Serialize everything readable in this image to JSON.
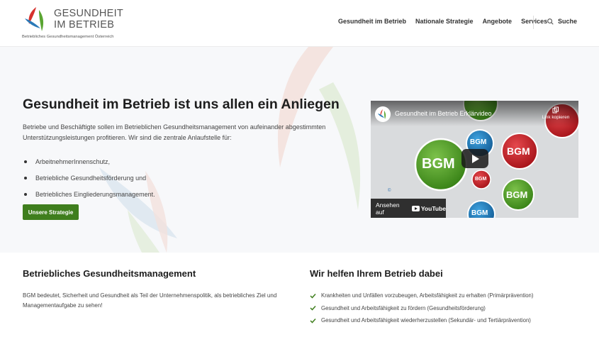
{
  "header": {
    "logo_line1": "GESUNDHEIT",
    "logo_line2": "IM BETRIEB",
    "logo_subtitle": "Betriebliches Gesundheitsmanagement Österreich",
    "nav": [
      {
        "label": "Gesundheit im Betrieb"
      },
      {
        "label": "Nationale Strategie"
      },
      {
        "label": "Angebote"
      },
      {
        "label": "Services"
      }
    ],
    "search_label": "Suche",
    "search_icon": "search-icon"
  },
  "hero": {
    "title": "Gesundheit im Betrieb ist uns allen ein Anliegen",
    "intro": "Betriebe und Beschäftigte sollen im Betrieblichen Gesundheitsmanagement von aufeinander abgestimmten Unterstützungsleistungen profitieren. Wir sind die zentrale Anlaufstelle für:",
    "list": [
      "ArbeitnehmerInnenschutz,",
      "Betriebliche Gesundheitsförderung und",
      "Betriebliches Eingliederungsmanagement."
    ],
    "button_label": "Unsere Strategie"
  },
  "video": {
    "title": "Gesundheit im Betrieb Erklärvideo",
    "share_label": "Link kopieren",
    "watch_on": "Ansehen auf",
    "youtube": "YouTube",
    "bubble_text": "BGM",
    "copyright": "©"
  },
  "bgm_section": {
    "title": "Betriebliches Gesundheitsmanagement",
    "text": "BGM bedeutet, Sicherheit und Gesundheit als Teil der Unternehmenspolitik, als betriebliches Ziel und Managementaufgabe zu sehen!"
  },
  "help_section": {
    "title": "Wir helfen Ihrem Betrieb dabei",
    "items": [
      "Krankheiten und Unfällen vorzubeugen, Arbeitsfähigkeit zu erhalten (Primärprävention)",
      "Gesundheit und Arbeitsfähigkeit zu fördern (Gesundheitsförderung)",
      "Gesundheit und Arbeitsfähigkeit wiederherzustellen (Sekundär- und Tertiärprävention)"
    ]
  },
  "colors": {
    "brand_green": "#3f7e1d",
    "logo_red": "#d6322e",
    "logo_blue": "#2a7ab8",
    "logo_green": "#5aa532",
    "bgm_green": "#4e9a26",
    "bgm_red": "#c7232a",
    "bgm_blue": "#1f7fc0"
  }
}
